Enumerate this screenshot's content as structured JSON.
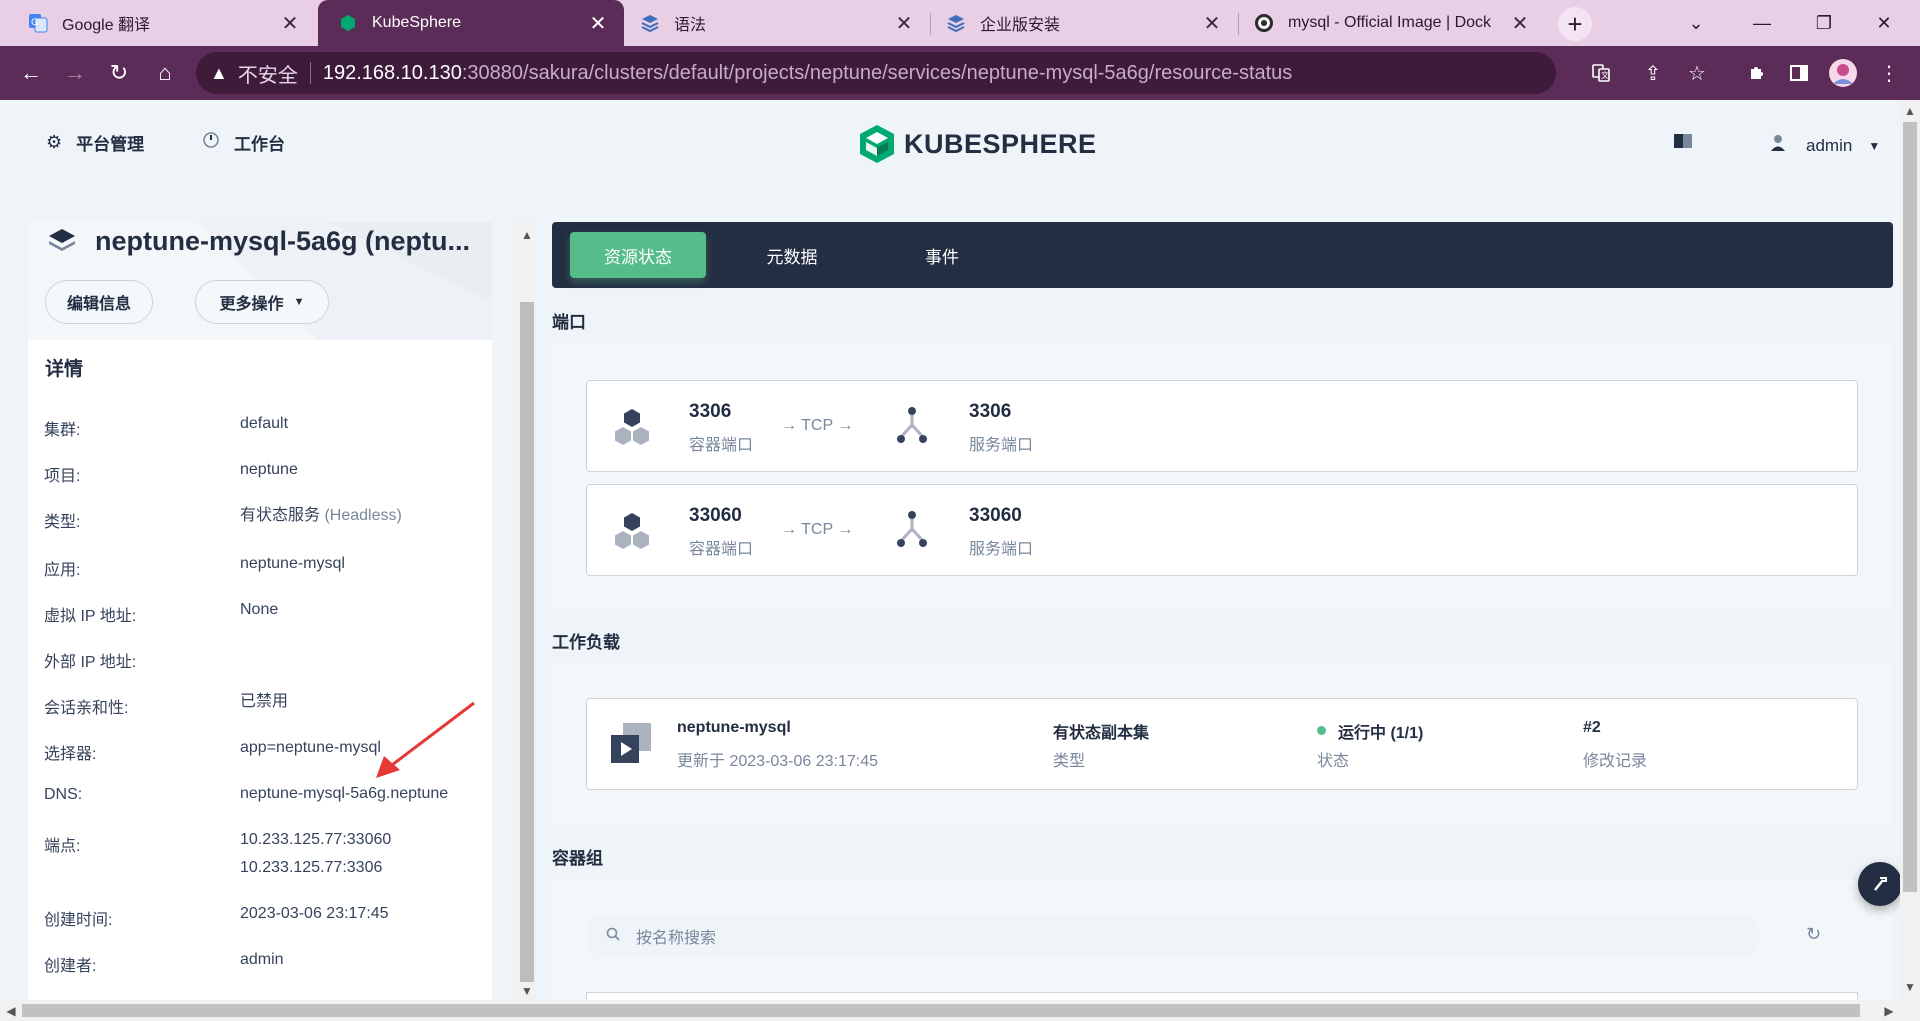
{
  "browser": {
    "tabs": [
      {
        "title": "Google 翻译",
        "icon": "google-translate-icon"
      },
      {
        "title": "KubeSphere",
        "icon": "kubesphere-icon"
      },
      {
        "title": "语法",
        "icon": "kubesphere-docs-icon"
      },
      {
        "title": "企业版安装",
        "icon": "kubesphere-docs-icon"
      },
      {
        "title": "mysql - Official Image | Dock",
        "icon": "docker-icon"
      }
    ],
    "insecure_label": "不安全",
    "url_host": "192.168.10.130",
    "url_path": ":30880/sakura/clusters/default/projects/neptune/services/neptune-mysql-5a6g/resource-status"
  },
  "header": {
    "platform": "平台管理",
    "workbench": "工作台",
    "logo_text": "KUBESPHERE",
    "user": "admin"
  },
  "service": {
    "title": "neptune-mysql-5a6g (neptu...",
    "edit_button": "编辑信息",
    "more_button": "更多操作",
    "details_heading": "详情",
    "details": [
      {
        "key": "集群:",
        "value": "default"
      },
      {
        "key": "项目:",
        "value": "neptune"
      },
      {
        "key": "类型:",
        "value": "有状态服务",
        "value_extra": "(Headless)"
      },
      {
        "key": "应用:",
        "value": "neptune-mysql"
      },
      {
        "key": "虚拟 IP 地址:",
        "value": "None"
      },
      {
        "key": "外部 IP 地址:",
        "value": ""
      },
      {
        "key": "会话亲和性:",
        "value": "已禁用"
      },
      {
        "key": "选择器:",
        "value": "app=neptune-mysql"
      },
      {
        "key": "DNS:",
        "value": "neptune-mysql-5a6g.neptune"
      },
      {
        "key": "端点:",
        "value": "10.233.125.77:33060",
        "value2": "10.233.125.77:3306"
      },
      {
        "key": "创建时间:",
        "value": "2023-03-06 23:17:45"
      },
      {
        "key": "创建者:",
        "value": "admin"
      }
    ]
  },
  "main": {
    "tabs": [
      "资源状态",
      "元数据",
      "事件"
    ],
    "ports_heading": "端口",
    "ports": [
      {
        "container_port": "3306",
        "container_label": "容器端口",
        "protocol": "→ TCP →",
        "service_port": "3306",
        "service_label": "服务端口"
      },
      {
        "container_port": "33060",
        "container_label": "容器端口",
        "protocol": "→ TCP →",
        "service_port": "33060",
        "service_label": "服务端口"
      }
    ],
    "workload_heading": "工作负载",
    "workload": {
      "name": "neptune-mysql",
      "updated": "更新于 2023-03-06 23:17:45",
      "type_value": "有状态副本集",
      "type_label": "类型",
      "status_value": "运行中 (1/1)",
      "status_label": "状态",
      "revision_value": "#2",
      "revision_label": "修改记录"
    },
    "pods_heading": "容器组",
    "search_placeholder": "按名称搜索"
  },
  "colors": {
    "accent": "#55bc8a",
    "dark": "#242e42",
    "chrome": "#5c2c58"
  }
}
